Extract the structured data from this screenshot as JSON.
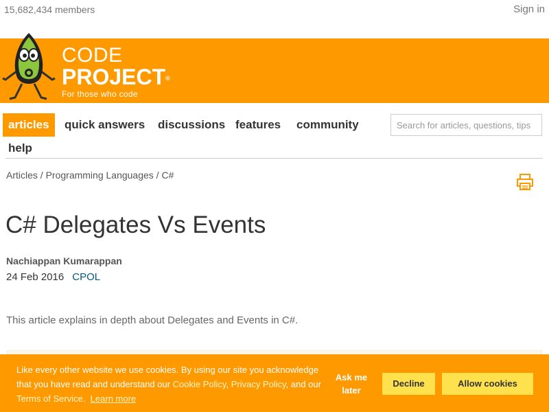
{
  "topbar": {
    "members": "15,682,434 members",
    "signin": "Sign in"
  },
  "brand": {
    "code": "CODE",
    "project": "PROJECT",
    "registered": "®",
    "tagline": "For those who code",
    "banner_color": "#ff9900",
    "mascot_icon": "bob-mascot-icon"
  },
  "nav": {
    "items": [
      {
        "label": "articles",
        "active": true
      },
      {
        "label": "quick answers",
        "active": false
      },
      {
        "label": "discussions",
        "active": false
      },
      {
        "label": "features",
        "active": false
      },
      {
        "label": "community",
        "active": false
      },
      {
        "label": "help",
        "active": false
      }
    ],
    "search_placeholder": "Search for articles, questions, tips"
  },
  "breadcrumb": {
    "items": [
      "Articles",
      "Programming Languages",
      "C#"
    ],
    "separator": " / ",
    "print_icon": "printer-icon"
  },
  "article": {
    "title": "C# Delegates Vs Events",
    "author": "Nachiappan Kumarappan",
    "date": "24 Feb 2016",
    "license": "CPOL",
    "summary": "This article explains in depth about Delegates and Events in C#."
  },
  "cookie": {
    "text_1": "Like every other website we use cookies. By using our site you acknowledge that you have read and understand our ",
    "cookie_policy": "Cookie Policy",
    "comma": ", ",
    "privacy_policy": "Privacy Policy",
    "and_our": ", and our ",
    "terms": "Terms of Service",
    "period": ".",
    "learn_more": "Learn more",
    "ask_me_later": "Ask me later",
    "decline": "Decline",
    "allow": "Allow cookies",
    "button_color": "#ffe14d"
  }
}
